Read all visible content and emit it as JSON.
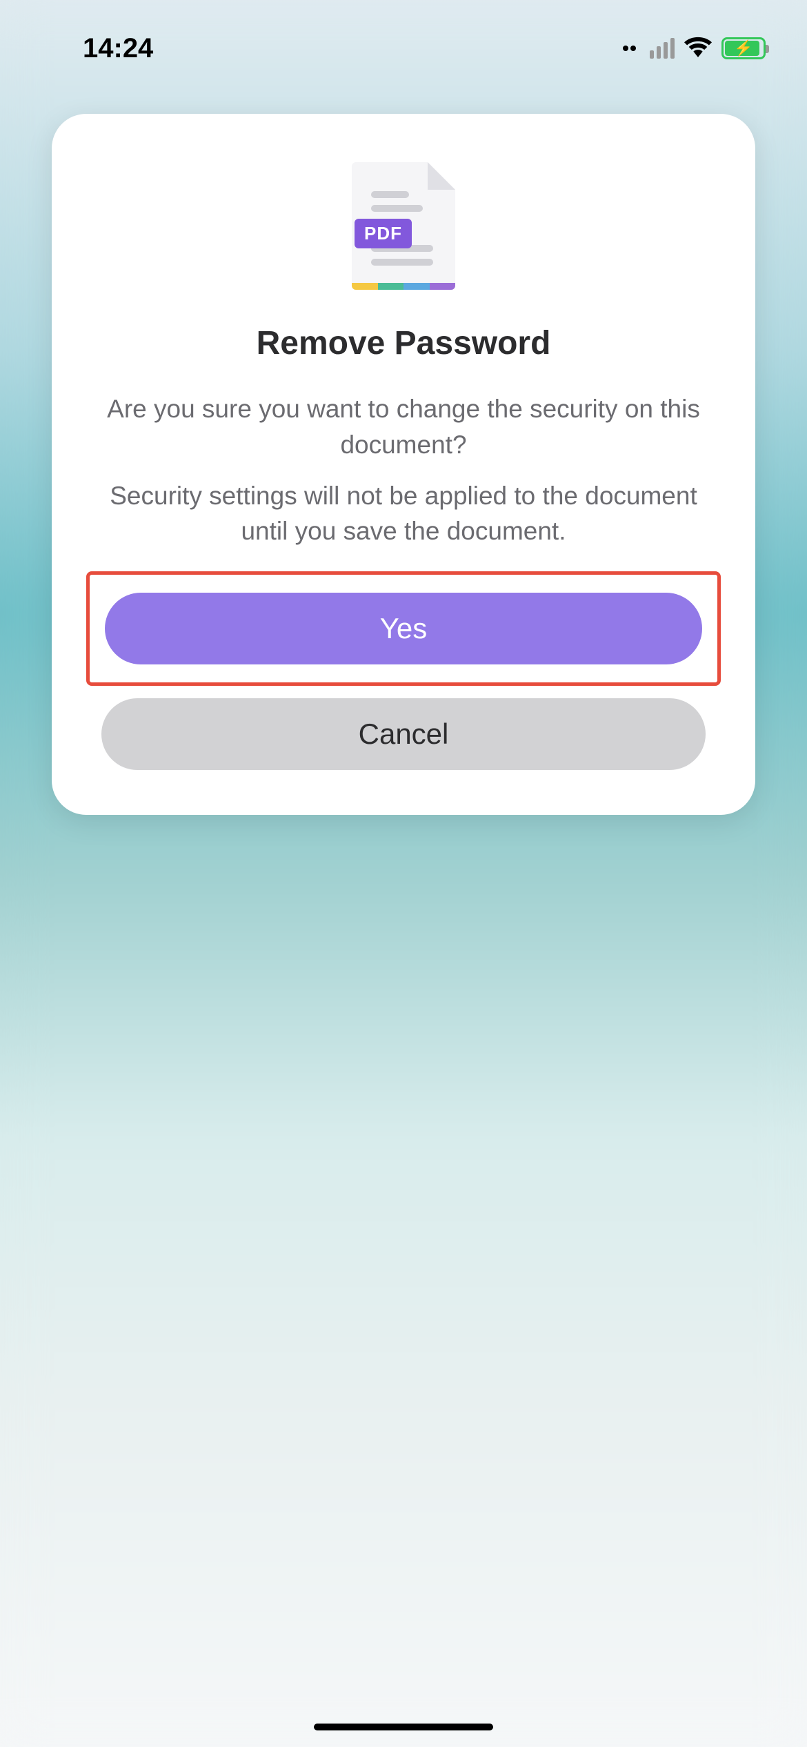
{
  "status_bar": {
    "time": "14:24"
  },
  "dialog": {
    "icon_badge": "PDF",
    "title": "Remove Password",
    "message_1": "Are you sure you want to change the security on this document?",
    "message_2": "Security settings will not be applied to the document until you save the document.",
    "yes_label": "Yes",
    "cancel_label": "Cancel"
  }
}
